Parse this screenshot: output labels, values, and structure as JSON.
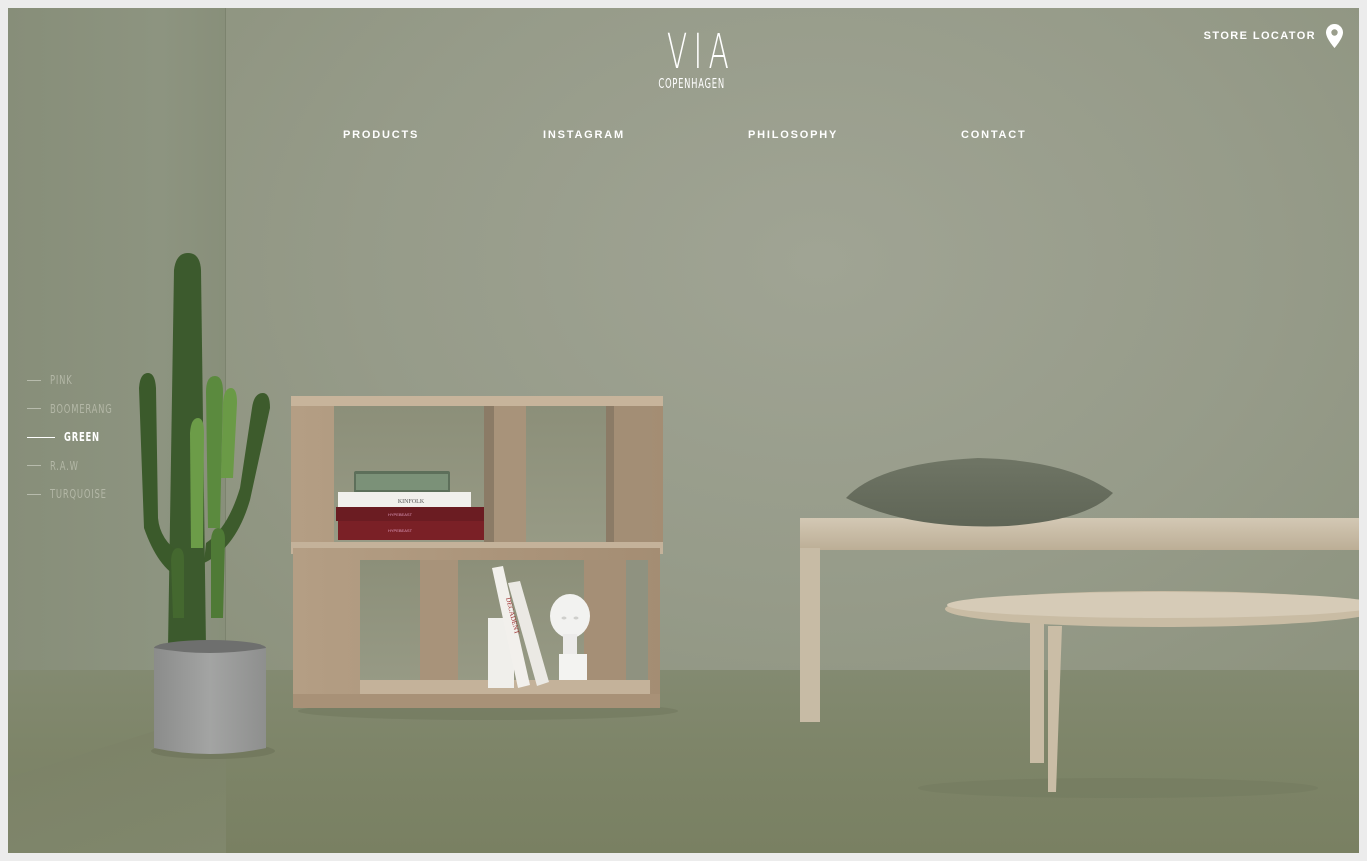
{
  "brand": {
    "name": "VIA",
    "tagline": "COPENHAGEN"
  },
  "header": {
    "store_locator_label": "STORE LOCATOR",
    "store_locator_icon": "map-pin-icon"
  },
  "nav": {
    "items": [
      {
        "label": "PRODUCTS"
      },
      {
        "label": "INSTAGRAM"
      },
      {
        "label": "PHILOSOPHY"
      },
      {
        "label": "CONTACT"
      }
    ]
  },
  "color_options": {
    "active": "GREEN",
    "items": [
      {
        "label": "PINK"
      },
      {
        "label": "BOOMERANG"
      },
      {
        "label": "GREEN"
      },
      {
        "label": "R.A.W"
      },
      {
        "label": "TURQUOISE"
      }
    ]
  },
  "book_spines": {
    "top_book": "KINFOLK",
    "red_book_1": "HYPEBEAST",
    "red_book_2": "HYPEBEAST",
    "upright_book": "DECADENT"
  },
  "colors": {
    "wall": "#969b89",
    "floor": "#7e8569",
    "text": "#ffffff",
    "inactive_text": "#b3b7a6",
    "wood": "#c6b59c"
  }
}
